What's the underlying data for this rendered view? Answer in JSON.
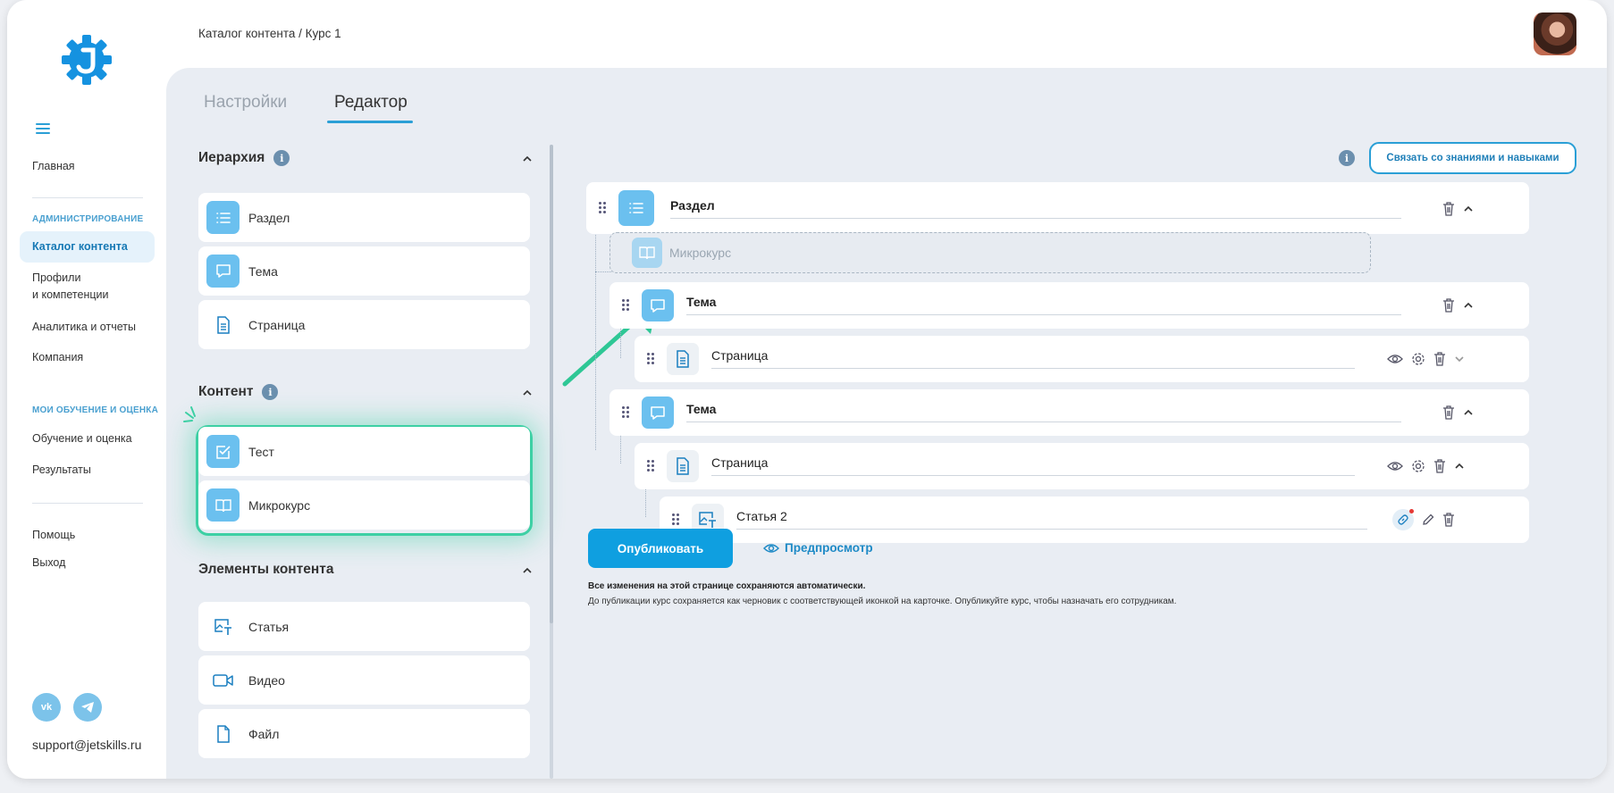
{
  "header": {
    "breadcrumb": "Каталог контента / Курс 1"
  },
  "sidebar": {
    "home": "Главная",
    "admin_heading": "АДМИНИСТРИРОВАНИЕ",
    "catalog": "Каталог контента",
    "profiles_line1": "Профили",
    "profiles_line2": "и компетенции",
    "analytics": "Аналитика и отчеты",
    "company": "Компания",
    "learning_heading": "МОИ ОБУЧЕНИЕ И ОЦЕНКА",
    "learning": "Обучение и оценка",
    "results": "Результаты",
    "help": "Помощь",
    "logout": "Выход",
    "social_vk": "vk",
    "social_tg": "tg",
    "support_email": "support@jetskills.ru"
  },
  "tabs": {
    "settings": "Настройки",
    "editor": "Редактор"
  },
  "library": {
    "hierarchy_title": "Иерархия",
    "hierarchy_items": [
      "Раздел",
      "Тема",
      "Страница"
    ],
    "content_title": "Контент",
    "content_items": [
      "Тест",
      "Микрокурс"
    ],
    "elements_title": "Элементы контента",
    "elements_items": [
      "Статья",
      "Видео",
      "Файл"
    ],
    "info": "i"
  },
  "editor": {
    "link_button": "Связать со знаниями и навыками",
    "info": "i",
    "ghost_item": "Микрокурс",
    "nodes": {
      "section": "Раздел",
      "topic1": "Тема",
      "page1": "Страница",
      "topic2": "Тема",
      "page2": "Страница",
      "article": "Статья 2"
    },
    "publish": "Опубликовать",
    "preview": "Предпросмотр",
    "note_bold": "Все изменения на этой странице сохраняются автоматически.",
    "note": "До публикации курс сохраняется как черновик с соответствующей иконкой на карточке. Опубликуйте курс, чтобы назначать его сотрудникам."
  },
  "colors": {
    "accent": "#2a9fd6",
    "highlight": "#3dd0a4",
    "icon_fill": "#6bc0ef"
  }
}
